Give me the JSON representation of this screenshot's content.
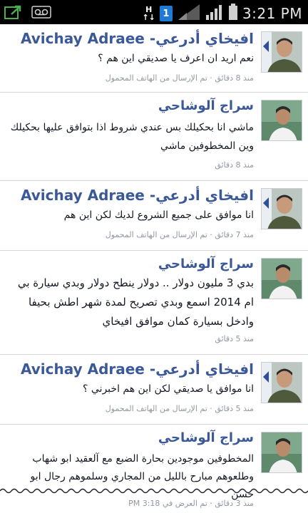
{
  "status_bar": {
    "time": "3:21 PM",
    "network_label": "H",
    "network_arrows": "↑↓",
    "sim_slot": "1",
    "icons": [
      "upload-icon",
      "voicemail-icon",
      "signal-icon",
      "battery-icon"
    ]
  },
  "colors": {
    "author_name": "#3b5998",
    "meta_text": "#9197a3",
    "divider": "#d3d6db",
    "status_bar": "#000000"
  },
  "posts": [
    {
      "author": "افيخاي أدرعي- Avichay Adraee",
      "text": "نعم اريد ان اعرف يا صديقي اين هم ؟",
      "time": "منذ 8 دقائق",
      "via": "تم الإرسال من الهاتف المحمول"
    },
    {
      "author": "سراج آلوشاحي",
      "text": "ماشي انا بحكيلك بس عندي شروط اذا بتوافق عليها بحكيلك وين المخطوفين ماشي",
      "time": "منذ 8 دقائق",
      "via": ""
    },
    {
      "author": "افيخاي أدرعي- Avichay Adraee",
      "text": "انا موافق على جميع الشروع لديك لكن اين هم",
      "time": "منذ 7 دقائق",
      "via": "تم الإرسال من الهاتف المحمول"
    },
    {
      "author": "سراج آلوشاحي",
      "text": "بدي 3 مليون دولار .. دولار ينطح دولار وبدي سيارة بي ام 2014 اسمع وبدي تصريح لمدة شهر اطش بحيفا وادخل بسيارة كمان موافق افيخاي",
      "time": "منذ 5 دقائق",
      "via": ""
    },
    {
      "author": "افيخاي أدرعي- Avichay Adraee",
      "text": "انا موافق يا صديقي لكن اين هم اخبرني ؟",
      "time": "منذ 5 دقائق",
      "via": "تم الإرسال من الهاتف المحمول"
    },
    {
      "author": "سراج آلوشاحي",
      "text": "المخطوفين موجودين بحارة الضبع مع آلعقيد ابو شهاب وطلعوهم مبارح بالليل من المجاري وسلموهم رجال ابو حسن",
      "time": "منذ 3 دقائق · تم العرض في 3:18 PM",
      "via": ""
    }
  ]
}
